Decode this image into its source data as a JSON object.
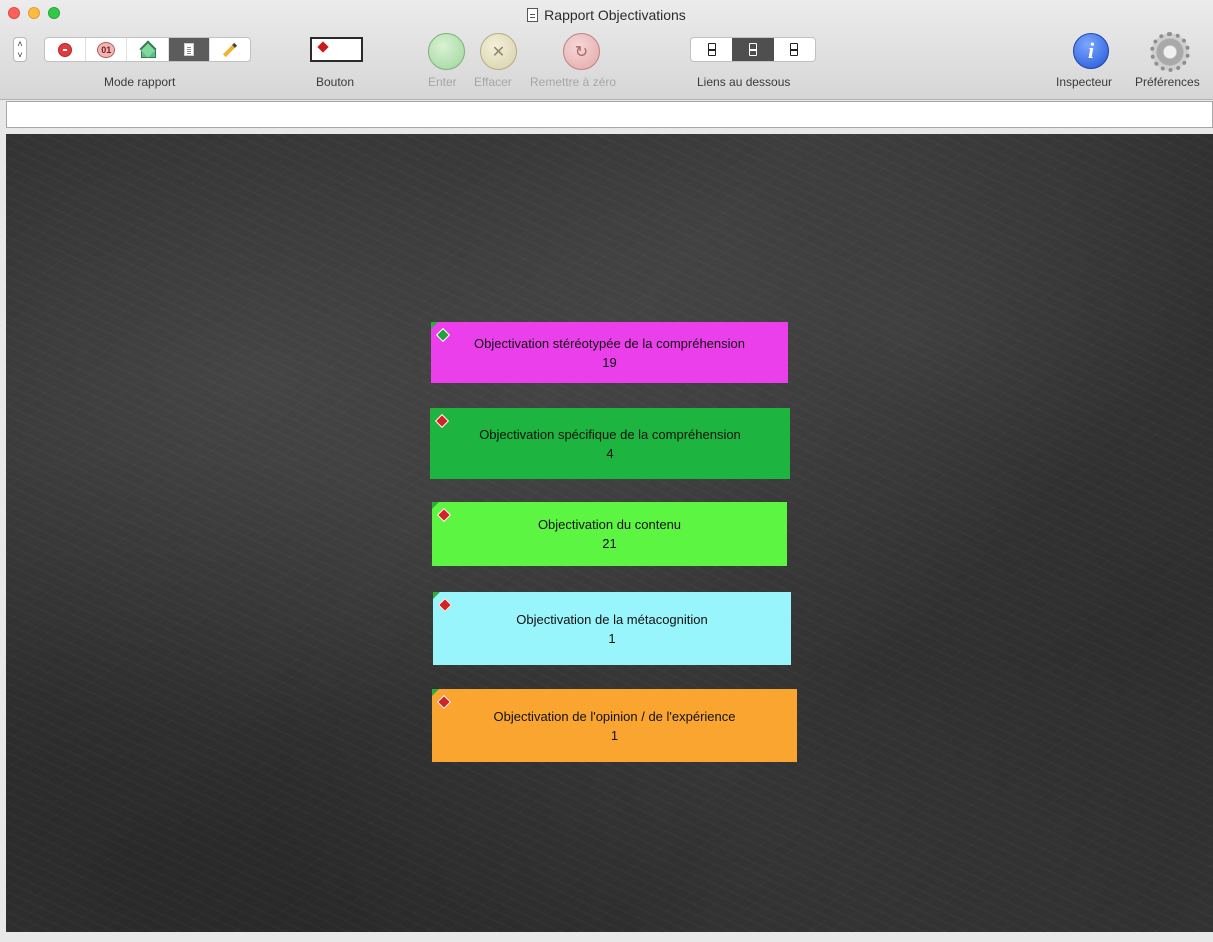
{
  "window": {
    "title": "Rapport Objectivations"
  },
  "toolbar": {
    "mode_label": "Mode rapport",
    "mode_badge": "01",
    "bouton_label": "Bouton",
    "enter_label": "Enter",
    "effacer_label": "Effacer",
    "reset_label": "Remettre à zéro",
    "links_label": "Liens au dessous",
    "inspector_label": "Inspecteur",
    "preferences_label": "Préférences",
    "info_glyph": "i",
    "clear_glyph": "✕",
    "reset_glyph": "↻"
  },
  "cards": [
    {
      "title": "Objectivation stéréotypée de la compréhension",
      "count": "19",
      "color": "#ec3fec",
      "marker": "green"
    },
    {
      "title": "Objectivation spécifique de la compréhension",
      "count": "4",
      "color": "#1db53f",
      "marker": "red"
    },
    {
      "title": "Objectivation du contenu",
      "count": "21",
      "color": "#5cf542",
      "marker": "red"
    },
    {
      "title": "Objectivation de la métacognition",
      "count": "1",
      "color": "#97f5fb",
      "marker": "red"
    },
    {
      "title": "Objectivation de l'opinion / de l'expérience",
      "count": "1",
      "color": "#f9a530",
      "marker": "red"
    }
  ]
}
